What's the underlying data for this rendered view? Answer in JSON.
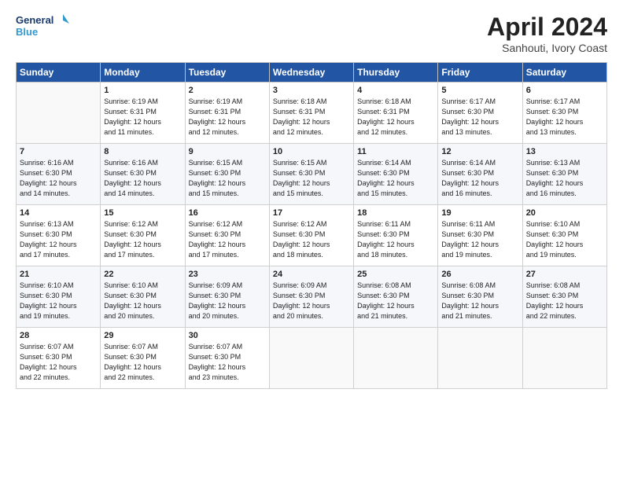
{
  "header": {
    "logo_line1": "General",
    "logo_line2": "Blue",
    "month_year": "April 2024",
    "location": "Sanhouti, Ivory Coast"
  },
  "weekdays": [
    "Sunday",
    "Monday",
    "Tuesday",
    "Wednesday",
    "Thursday",
    "Friday",
    "Saturday"
  ],
  "weeks": [
    [
      {
        "day": "",
        "info": ""
      },
      {
        "day": "1",
        "info": "Sunrise: 6:19 AM\nSunset: 6:31 PM\nDaylight: 12 hours\nand 11 minutes."
      },
      {
        "day": "2",
        "info": "Sunrise: 6:19 AM\nSunset: 6:31 PM\nDaylight: 12 hours\nand 12 minutes."
      },
      {
        "day": "3",
        "info": "Sunrise: 6:18 AM\nSunset: 6:31 PM\nDaylight: 12 hours\nand 12 minutes."
      },
      {
        "day": "4",
        "info": "Sunrise: 6:18 AM\nSunset: 6:31 PM\nDaylight: 12 hours\nand 12 minutes."
      },
      {
        "day": "5",
        "info": "Sunrise: 6:17 AM\nSunset: 6:30 PM\nDaylight: 12 hours\nand 13 minutes."
      },
      {
        "day": "6",
        "info": "Sunrise: 6:17 AM\nSunset: 6:30 PM\nDaylight: 12 hours\nand 13 minutes."
      }
    ],
    [
      {
        "day": "7",
        "info": "Sunrise: 6:16 AM\nSunset: 6:30 PM\nDaylight: 12 hours\nand 14 minutes."
      },
      {
        "day": "8",
        "info": "Sunrise: 6:16 AM\nSunset: 6:30 PM\nDaylight: 12 hours\nand 14 minutes."
      },
      {
        "day": "9",
        "info": "Sunrise: 6:15 AM\nSunset: 6:30 PM\nDaylight: 12 hours\nand 15 minutes."
      },
      {
        "day": "10",
        "info": "Sunrise: 6:15 AM\nSunset: 6:30 PM\nDaylight: 12 hours\nand 15 minutes."
      },
      {
        "day": "11",
        "info": "Sunrise: 6:14 AM\nSunset: 6:30 PM\nDaylight: 12 hours\nand 15 minutes."
      },
      {
        "day": "12",
        "info": "Sunrise: 6:14 AM\nSunset: 6:30 PM\nDaylight: 12 hours\nand 16 minutes."
      },
      {
        "day": "13",
        "info": "Sunrise: 6:13 AM\nSunset: 6:30 PM\nDaylight: 12 hours\nand 16 minutes."
      }
    ],
    [
      {
        "day": "14",
        "info": "Sunrise: 6:13 AM\nSunset: 6:30 PM\nDaylight: 12 hours\nand 17 minutes."
      },
      {
        "day": "15",
        "info": "Sunrise: 6:12 AM\nSunset: 6:30 PM\nDaylight: 12 hours\nand 17 minutes."
      },
      {
        "day": "16",
        "info": "Sunrise: 6:12 AM\nSunset: 6:30 PM\nDaylight: 12 hours\nand 17 minutes."
      },
      {
        "day": "17",
        "info": "Sunrise: 6:12 AM\nSunset: 6:30 PM\nDaylight: 12 hours\nand 18 minutes."
      },
      {
        "day": "18",
        "info": "Sunrise: 6:11 AM\nSunset: 6:30 PM\nDaylight: 12 hours\nand 18 minutes."
      },
      {
        "day": "19",
        "info": "Sunrise: 6:11 AM\nSunset: 6:30 PM\nDaylight: 12 hours\nand 19 minutes."
      },
      {
        "day": "20",
        "info": "Sunrise: 6:10 AM\nSunset: 6:30 PM\nDaylight: 12 hours\nand 19 minutes."
      }
    ],
    [
      {
        "day": "21",
        "info": "Sunrise: 6:10 AM\nSunset: 6:30 PM\nDaylight: 12 hours\nand 19 minutes."
      },
      {
        "day": "22",
        "info": "Sunrise: 6:10 AM\nSunset: 6:30 PM\nDaylight: 12 hours\nand 20 minutes."
      },
      {
        "day": "23",
        "info": "Sunrise: 6:09 AM\nSunset: 6:30 PM\nDaylight: 12 hours\nand 20 minutes."
      },
      {
        "day": "24",
        "info": "Sunrise: 6:09 AM\nSunset: 6:30 PM\nDaylight: 12 hours\nand 20 minutes."
      },
      {
        "day": "25",
        "info": "Sunrise: 6:08 AM\nSunset: 6:30 PM\nDaylight: 12 hours\nand 21 minutes."
      },
      {
        "day": "26",
        "info": "Sunrise: 6:08 AM\nSunset: 6:30 PM\nDaylight: 12 hours\nand 21 minutes."
      },
      {
        "day": "27",
        "info": "Sunrise: 6:08 AM\nSunset: 6:30 PM\nDaylight: 12 hours\nand 22 minutes."
      }
    ],
    [
      {
        "day": "28",
        "info": "Sunrise: 6:07 AM\nSunset: 6:30 PM\nDaylight: 12 hours\nand 22 minutes."
      },
      {
        "day": "29",
        "info": "Sunrise: 6:07 AM\nSunset: 6:30 PM\nDaylight: 12 hours\nand 22 minutes."
      },
      {
        "day": "30",
        "info": "Sunrise: 6:07 AM\nSunset: 6:30 PM\nDaylight: 12 hours\nand 23 minutes."
      },
      {
        "day": "",
        "info": ""
      },
      {
        "day": "",
        "info": ""
      },
      {
        "day": "",
        "info": ""
      },
      {
        "day": "",
        "info": ""
      }
    ]
  ]
}
